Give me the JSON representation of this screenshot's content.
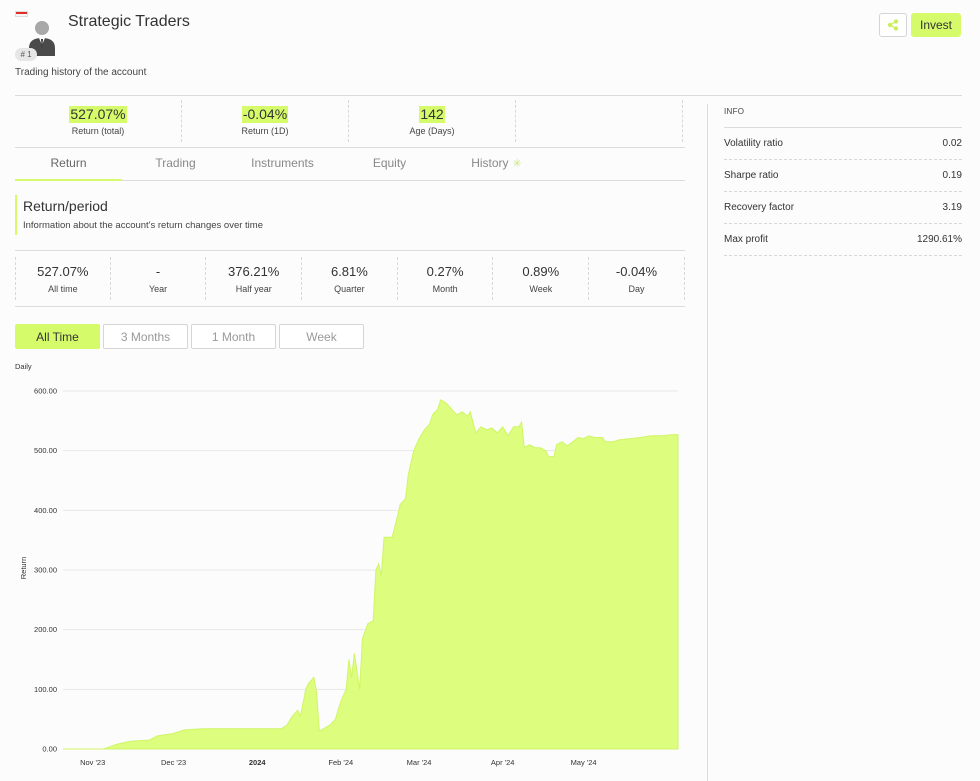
{
  "header": {
    "title": "Strategic Traders",
    "subtitle": "Trading history of the account",
    "rank_badge": "# 1",
    "invest_label": "Invest"
  },
  "kpis": [
    {
      "value": "527.07%",
      "label": "Return (total)"
    },
    {
      "value": "-0.04%",
      "label": "Return (1D)"
    },
    {
      "value": "142",
      "label": "Age (Days)"
    }
  ],
  "tabs": [
    {
      "label": "Return",
      "active": true
    },
    {
      "label": "Trading"
    },
    {
      "label": "Instruments"
    },
    {
      "label": "Equity"
    },
    {
      "label": "History"
    }
  ],
  "section": {
    "title": "Return/period",
    "description": "Information about the account's return changes over time"
  },
  "periods": [
    {
      "value": "527.07%",
      "label": "All time"
    },
    {
      "value": "-",
      "label": "Year"
    },
    {
      "value": "376.21%",
      "label": "Half year"
    },
    {
      "value": "6.81%",
      "label": "Quarter"
    },
    {
      "value": "0.27%",
      "label": "Month"
    },
    {
      "value": "0.89%",
      "label": "Week"
    },
    {
      "value": "-0.04%",
      "label": "Day"
    }
  ],
  "ranges": [
    "All Time",
    "3 Months",
    "1 Month",
    "Week"
  ],
  "chart_label": "Daily",
  "info": {
    "title": "INFO",
    "rows": [
      {
        "label": "Volatility ratio",
        "value": "0.02"
      },
      {
        "label": "Sharpe ratio",
        "value": "0.19"
      },
      {
        "label": "Recovery factor",
        "value": "3.19"
      },
      {
        "label": "Max profit",
        "value": "1290.61%"
      }
    ]
  },
  "colors": {
    "accent": "#d6fb6a",
    "area_fill": "#dcfd7e"
  },
  "chart_data": {
    "type": "area",
    "ylabel": "Return",
    "ylim": [
      0,
      600
    ],
    "yticks": [
      "0.00",
      "100.00",
      "200.00",
      "300.00",
      "400.00",
      "500.00",
      "600.00"
    ],
    "xlim": [
      "2023-10-21",
      "2024-06-05"
    ],
    "xticks": [
      {
        "date": "2023-11-01",
        "label": "Nov '23"
      },
      {
        "date": "2023-12-01",
        "label": "Dec '23"
      },
      {
        "date": "2024-01-01",
        "label": "2024"
      },
      {
        "date": "2024-02-01",
        "label": "Feb '24"
      },
      {
        "date": "2024-03-01",
        "label": "Mar '24"
      },
      {
        "date": "2024-04-01",
        "label": "Apr '24"
      },
      {
        "date": "2024-05-01",
        "label": "May '24"
      }
    ],
    "grid": true,
    "legend": "none",
    "series": [
      {
        "points": [
          [
            "2023-10-21",
            0
          ],
          [
            "2023-11-05",
            0
          ],
          [
            "2023-11-10",
            8
          ],
          [
            "2023-11-15",
            13
          ],
          [
            "2023-11-22",
            15
          ],
          [
            "2023-11-25",
            22
          ],
          [
            "2023-12-01",
            26
          ],
          [
            "2023-12-05",
            32
          ],
          [
            "2023-12-12",
            34
          ],
          [
            "2023-12-20",
            34
          ],
          [
            "2024-01-01",
            34
          ],
          [
            "2024-01-05",
            34
          ],
          [
            "2024-01-10",
            34
          ],
          [
            "2024-01-12",
            40
          ],
          [
            "2024-01-14",
            55
          ],
          [
            "2024-01-16",
            65
          ],
          [
            "2024-01-17",
            55
          ],
          [
            "2024-01-19",
            100
          ],
          [
            "2024-01-20",
            110
          ],
          [
            "2024-01-22",
            120
          ],
          [
            "2024-01-23",
            95
          ],
          [
            "2024-01-24",
            30
          ],
          [
            "2024-01-26",
            35
          ],
          [
            "2024-01-28",
            40
          ],
          [
            "2024-01-30",
            50
          ],
          [
            "2024-02-01",
            80
          ],
          [
            "2024-02-03",
            100
          ],
          [
            "2024-02-04",
            150
          ],
          [
            "2024-02-05",
            120
          ],
          [
            "2024-02-06",
            160
          ],
          [
            "2024-02-08",
            100
          ],
          [
            "2024-02-09",
            185
          ],
          [
            "2024-02-11",
            210
          ],
          [
            "2024-02-13",
            215
          ],
          [
            "2024-02-14",
            300
          ],
          [
            "2024-02-15",
            310
          ],
          [
            "2024-02-16",
            290
          ],
          [
            "2024-02-17",
            355
          ],
          [
            "2024-02-20",
            355
          ],
          [
            "2024-02-22",
            390
          ],
          [
            "2024-02-23",
            410
          ],
          [
            "2024-02-25",
            420
          ],
          [
            "2024-02-26",
            460
          ],
          [
            "2024-02-28",
            500
          ],
          [
            "2024-03-01",
            520
          ],
          [
            "2024-03-03",
            535
          ],
          [
            "2024-03-05",
            545
          ],
          [
            "2024-03-06",
            560
          ],
          [
            "2024-03-08",
            570
          ],
          [
            "2024-03-09",
            585
          ],
          [
            "2024-03-11",
            580
          ],
          [
            "2024-03-13",
            570
          ],
          [
            "2024-03-15",
            560
          ],
          [
            "2024-03-17",
            565
          ],
          [
            "2024-03-19",
            558
          ],
          [
            "2024-03-20",
            565
          ],
          [
            "2024-03-22",
            530
          ],
          [
            "2024-03-24",
            540
          ],
          [
            "2024-03-26",
            535
          ],
          [
            "2024-03-28",
            538
          ],
          [
            "2024-03-30",
            530
          ],
          [
            "2024-04-01",
            540
          ],
          [
            "2024-04-03",
            525
          ],
          [
            "2024-04-05",
            540
          ],
          [
            "2024-04-07",
            540
          ],
          [
            "2024-04-08",
            548
          ],
          [
            "2024-04-09",
            505
          ],
          [
            "2024-04-11",
            510
          ],
          [
            "2024-04-13",
            505
          ],
          [
            "2024-04-15",
            505
          ],
          [
            "2024-04-17",
            500
          ],
          [
            "2024-04-18",
            490
          ],
          [
            "2024-04-20",
            490
          ],
          [
            "2024-04-21",
            510
          ],
          [
            "2024-04-23",
            515
          ],
          [
            "2024-04-25",
            508
          ],
          [
            "2024-04-27",
            515
          ],
          [
            "2024-04-29",
            522
          ],
          [
            "2024-05-01",
            520
          ],
          [
            "2024-05-03",
            525
          ],
          [
            "2024-05-05",
            522
          ],
          [
            "2024-05-08",
            522
          ],
          [
            "2024-05-09",
            515
          ],
          [
            "2024-05-12",
            515
          ],
          [
            "2024-05-14",
            518
          ],
          [
            "2024-05-18",
            520
          ],
          [
            "2024-05-22",
            522
          ],
          [
            "2024-05-26",
            525
          ],
          [
            "2024-05-30",
            525
          ],
          [
            "2024-06-03",
            527
          ],
          [
            "2024-06-05",
            527
          ]
        ]
      }
    ]
  }
}
